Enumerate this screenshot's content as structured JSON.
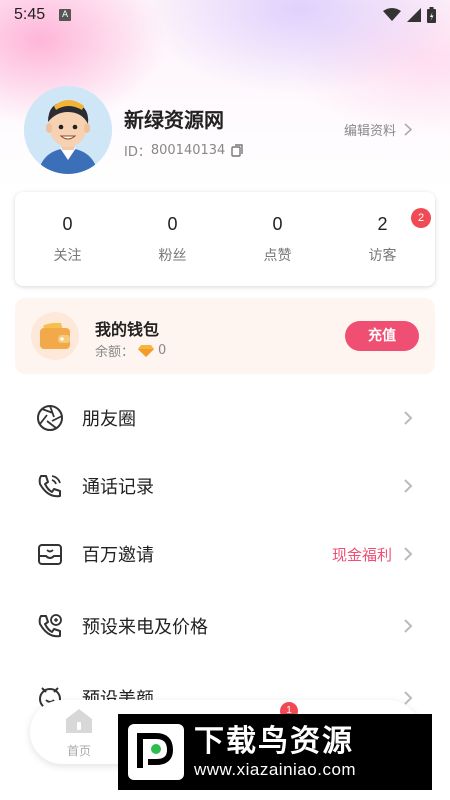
{
  "status_bar": {
    "time": "5:45",
    "notification_icon": "A"
  },
  "profile": {
    "nickname": "新绿资源网",
    "id_label": "ID：",
    "id_value": "800140134",
    "edit_label": "编辑资料"
  },
  "stats": [
    {
      "value": "0",
      "label": "关注"
    },
    {
      "value": "0",
      "label": "粉丝"
    },
    {
      "value": "0",
      "label": "点赞"
    },
    {
      "value": "2",
      "label": "访客",
      "badge": "2"
    }
  ],
  "wallet": {
    "title": "我的钱包",
    "balance_label": "余额：",
    "balance_value": "0",
    "recharge_label": "充值"
  },
  "menu": [
    {
      "icon": "aperture-icon",
      "label": "朋友圈",
      "extra": ""
    },
    {
      "icon": "phone-call-icon",
      "label": "通话记录",
      "extra": ""
    },
    {
      "icon": "invite-icon",
      "label": "百万邀请",
      "extra": "现金福利"
    },
    {
      "icon": "phone-price-icon",
      "label": "预设来电及价格",
      "extra": ""
    },
    {
      "icon": "beauty-icon",
      "label": "预设美颜",
      "extra": ""
    }
  ],
  "tabbar": {
    "home_label": "首页",
    "badge_1": "1"
  },
  "watermark": {
    "title": "下载鸟资源",
    "url": "www.xiazainiao.com"
  },
  "colors": {
    "accent": "#ef4f73",
    "badge": "#f04a55",
    "wallet_bg": "#fff5f0"
  }
}
